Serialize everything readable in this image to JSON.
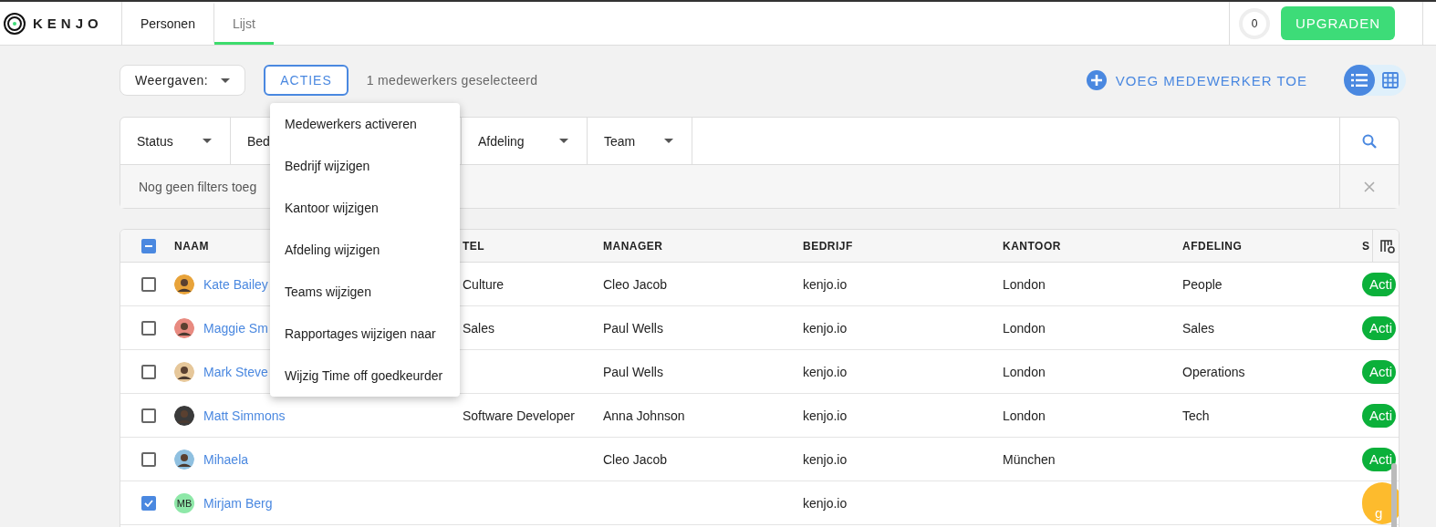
{
  "header": {
    "logo": "KENJO",
    "tabs": [
      {
        "label": "Personen",
        "selected": false
      },
      {
        "label": "Lijst",
        "selected": true
      }
    ],
    "counter": "0",
    "upgrade": "UPGRADEN"
  },
  "toolbar": {
    "views": "Weergaven:",
    "actions": "ACTIES",
    "selection": "1 medewerkers geselecteerd",
    "add": "VOEG MEDEWERKER TOE",
    "view_modes": [
      {
        "kind": "list",
        "selected": true
      },
      {
        "kind": "grid",
        "selected": false
      }
    ]
  },
  "filters": {
    "dropdowns": [
      {
        "label": "Status"
      },
      {
        "label": "Bed"
      },
      {
        "label": "Afdeling"
      },
      {
        "label": "Team"
      }
    ],
    "empty": "Nog geen filters toeg"
  },
  "table": {
    "select_all": {
      "indeterminate": true
    },
    "columns": [
      "NAAM",
      "TEL",
      "MANAGER",
      "BEDRIJF",
      "KANTOOR",
      "AFDELING",
      "S"
    ],
    "rows": [
      {
        "checked": false,
        "avatar": {
          "kind": "photo",
          "color": "#e8a33a"
        },
        "name": "Kate Bailey",
        "title": "Culture",
        "manager": "Cleo Jacob",
        "company": "kenjo.io",
        "office": "London",
        "department": "People",
        "status": {
          "kind": "active",
          "label": "Acti"
        }
      },
      {
        "checked": false,
        "avatar": {
          "kind": "photo",
          "color": "#e88a80"
        },
        "name": "Maggie Sm",
        "title": "Sales",
        "manager": "Paul Wells",
        "company": "kenjo.io",
        "office": "London",
        "department": "Sales",
        "status": {
          "kind": "active",
          "label": "Acti"
        }
      },
      {
        "checked": false,
        "avatar": {
          "kind": "photo",
          "color": "#e6c79a"
        },
        "name": "Mark Steve",
        "title": "",
        "manager": "Paul Wells",
        "company": "kenjo.io",
        "office": "London",
        "department": "Operations",
        "status": {
          "kind": "active",
          "label": "Acti"
        }
      },
      {
        "checked": false,
        "avatar": {
          "kind": "photo",
          "color": "#3a3a3a"
        },
        "name": "Matt Simmons",
        "title": "Software Developer",
        "manager": "Anna Johnson",
        "company": "kenjo.io",
        "office": "London",
        "department": "Tech",
        "status": {
          "kind": "active",
          "label": "Acti"
        }
      },
      {
        "checked": false,
        "avatar": {
          "kind": "photo",
          "color": "#8fc0e0"
        },
        "name": "Mihaela",
        "title": "",
        "manager": "Cleo Jacob",
        "company": "kenjo.io",
        "office": "München",
        "department": "",
        "status": {
          "kind": "active",
          "label": "Acti"
        }
      },
      {
        "checked": true,
        "avatar": {
          "kind": "initials",
          "initials": "MB",
          "color": "#8ee8a8"
        },
        "name": "Mirjam Berg",
        "title": "",
        "manager": "",
        "company": "kenjo.io",
        "office": "",
        "department": "",
        "status": {
          "kind": "pending",
          "label": "g"
        }
      }
    ]
  },
  "actions_menu": {
    "items": [
      "Medewerkers activeren",
      "Bedrijf wijzigen",
      "Kantoor wijzigen",
      "Afdeling wijzigen",
      "Teams wijzigen",
      "Rapportages wijzigen naar",
      "Wijzig Time off goedkeurder"
    ]
  }
}
